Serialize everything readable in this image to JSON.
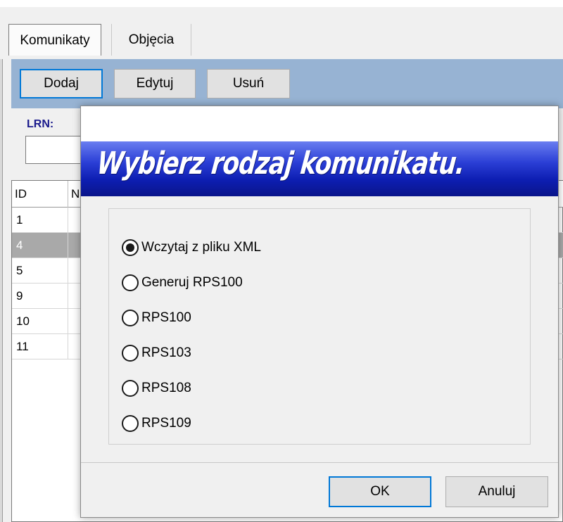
{
  "tabs": [
    "Komunikaty",
    "Objęcia"
  ],
  "toolbar": {
    "add": "Dodaj",
    "edit": "Edytuj",
    "delete": "Usuń"
  },
  "filter": {
    "lrn_label": "LRN:",
    "lrn_value": ""
  },
  "grid": {
    "columns": [
      "ID",
      "N"
    ],
    "rows": [
      {
        "id": "1",
        "selected": false
      },
      {
        "id": "4",
        "selected": true
      },
      {
        "id": "5",
        "selected": false
      },
      {
        "id": "9",
        "selected": false
      },
      {
        "id": "10",
        "selected": false
      },
      {
        "id": "11",
        "selected": false
      }
    ]
  },
  "dialog": {
    "banner_title": "Wybierz rodzaj komunikatu.",
    "options": [
      {
        "label": "Wczytaj z pliku XML",
        "checked": true
      },
      {
        "label": "Generuj RPS100",
        "checked": false
      },
      {
        "label": "RPS100",
        "checked": false
      },
      {
        "label": "RPS103",
        "checked": false
      },
      {
        "label": "RPS108",
        "checked": false
      },
      {
        "label": "RPS109",
        "checked": false
      }
    ],
    "ok_label": "OK",
    "cancel_label": "Anuluj"
  },
  "colors": {
    "toolbar_bg": "#97b3d3",
    "banner_blue": "#0d1eb2",
    "focus_border": "#0078d7",
    "selected_row": "#a9a9a9"
  }
}
